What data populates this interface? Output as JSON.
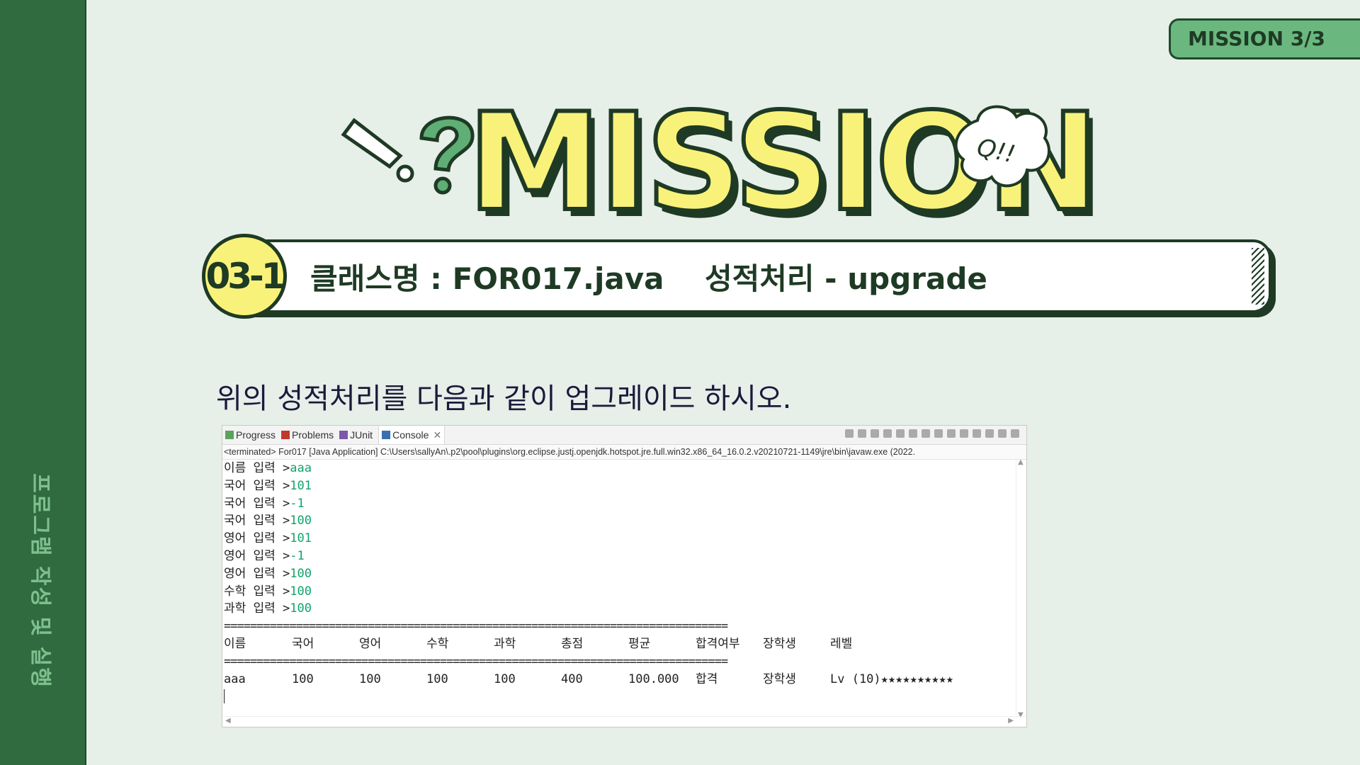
{
  "sidebar": {
    "title": "프로그램 작성 및 실행"
  },
  "badge": {
    "label": "MISSION 3/3"
  },
  "hero": {
    "title": "MISSION",
    "bubble_text": "Q!!"
  },
  "task": {
    "number": "03-1",
    "class_label": "클래스명 : FOR017.java",
    "topic": "성적처리 - upgrade"
  },
  "instruction": "위의 성적처리를 다음과 같이 업그레이드 하시오.",
  "console": {
    "tabs": [
      {
        "label": "Progress"
      },
      {
        "label": "Problems"
      },
      {
        "label": "JUnit"
      },
      {
        "label": "Console"
      }
    ],
    "path": "<terminated> For017 [Java Application] C:\\Users\\sallyAn\\.p2\\pool\\plugins\\org.eclipse.justj.openjdk.hotspot.jre.full.win32.x86_64_16.0.2.v20210721-1149\\jre\\bin\\javaw.exe  (2022.",
    "inputs": [
      {
        "prompt": "이름 입력 >",
        "value": "aaa"
      },
      {
        "prompt": "국어 입력 >",
        "value": "101"
      },
      {
        "prompt": "국어 입력 >",
        "value": "-1"
      },
      {
        "prompt": "국어 입력 >",
        "value": "100"
      },
      {
        "prompt": "영어 입력 >",
        "value": "101"
      },
      {
        "prompt": "영어 입력 >",
        "value": "-1"
      },
      {
        "prompt": "영어 입력 >",
        "value": "100"
      },
      {
        "prompt": "수학 입력 >",
        "value": "100"
      },
      {
        "prompt": "과학 입력 >",
        "value": "100"
      }
    ],
    "separator": "=============================================================================",
    "headers": [
      "이름",
      "국어",
      "영어",
      "수학",
      "과학",
      "총점",
      "평균",
      "합격여부",
      "장학생",
      "레벨"
    ],
    "row": [
      "aaa",
      "100",
      "100",
      "100",
      "100",
      "400",
      "100.000",
      "합격",
      "장학생",
      "Lv (10)★★★★★★★★★★"
    ]
  }
}
